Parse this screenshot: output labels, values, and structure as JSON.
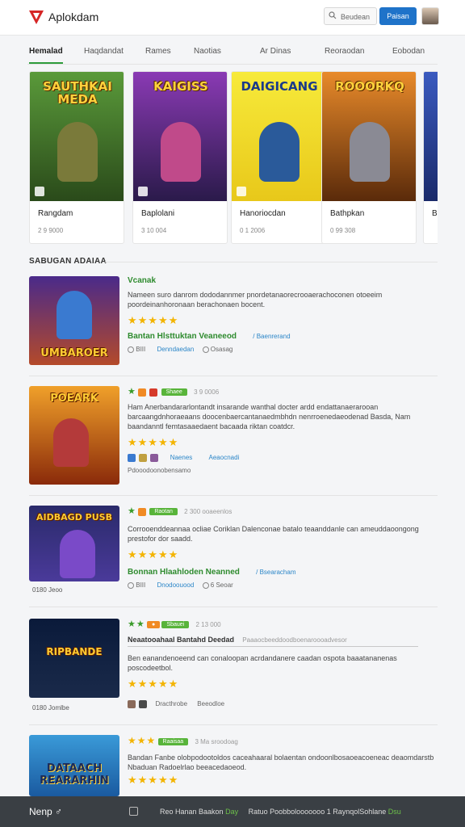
{
  "header": {
    "brand": "Aplokdam",
    "search_placeholder": "Beudean",
    "primary_button": "Paisan"
  },
  "tabs": [
    {
      "label": "Hemalad"
    },
    {
      "label": "Haqdandat"
    },
    {
      "label": "Rames"
    },
    {
      "label": "Naotias"
    },
    {
      "label": "Ar Dinas"
    },
    {
      "label": "Reoraodan"
    },
    {
      "label": "Eobodan"
    }
  ],
  "featured": [
    {
      "art_title": "SAUTHKAI MEDA",
      "name": "Rangdam",
      "meta": "2 9 9000",
      "bg": "#3a7a2a",
      "fig": "#6b7b3a"
    },
    {
      "art_title": "KAIGISS",
      "name": "Baplolani",
      "meta": "3 10 004",
      "bg": "#6a2a9a",
      "fig": "#b43d7a"
    },
    {
      "art_title": "DAIGICANG",
      "name": "Hanoriocdan",
      "meta": "0 1 2006",
      "bg": "#f1df2a",
      "fig": "#2a5a9a"
    },
    {
      "art_title": "ROOORKQ",
      "name": "Bathpkan",
      "meta": "0 99 308",
      "bg": "#d46a1a",
      "fig": "#7a7a84"
    },
    {
      "art_title": "",
      "name": "Bi",
      "meta": "",
      "bg": "#2a4a9a",
      "fig": "#d0a040"
    }
  ],
  "section_title": "SABUGAN ADAIAA",
  "list": [
    {
      "thumb_title": "UMBAROER",
      "title": "Vcanak",
      "desc": "Nameen suro danrom dododannmer pnordetanaorecrooaerachoconen otoeeim poordeinanhoronaan berachonaen bocent.",
      "stars": "★★★★★",
      "green_line": "Bantan Hlsttuktan   Veaneeod",
      "green_link": "/ Baenrerand",
      "meta_a": "BIII",
      "meta_b": "Denndaedan",
      "meta_c": "Osasag"
    },
    {
      "thumb_title": "POEARK",
      "badge": "Shaee",
      "date": "3 9 0006",
      "desc": "Ham Anerbandararlontandt insarande wanthal docter ardd endattanaerarooan barcaangdnhoraeaans doocenbaercantanaedmbhdn nenrroenedaeodenad Basda, Nam baandanntl femtasaaedaent bacaada riktan coatdcr.",
      "stars": "★★★★★",
      "blue_a": "Naenes",
      "blue_b": "Aeaocnadi",
      "foot": "Pdooodoonobensamo"
    },
    {
      "thumb_title": "AIDBAGD PUSB",
      "badge": "Raotan",
      "date": "2 300 ooaeenlos",
      "desc": "Corrooenddeannaa ocliae Coriklan Dalenconae batalo teaanddanle can ameuddaoongong prestofor dor saadd.",
      "stars": "★★★★★",
      "green_line": "Bonnan Hlaahloden   Neanned",
      "green_link": "/ Bsearacham",
      "label_a": "0180 Jeoo",
      "meta_a": "BIII",
      "meta_b": "Dnodoouood",
      "meta_c": "6 Seoar"
    },
    {
      "thumb_title": "RIPBANDE",
      "badge": "Sbauei",
      "date": "2 13 000",
      "heading": "Neaatooahaal Bantahd Deedad",
      "heading_tail": "Paaaocbeeddoodboenaroooadvesor",
      "desc": "Ben eanandenoeend can conaloopan acrdandanere caadan ospota baaatananenas poscodeetbol.",
      "stars": "★★★★★",
      "label_a": "0180 Jomlbe",
      "meta_b": "Dracthrobe",
      "meta_c": "Beeodloe"
    },
    {
      "thumb_title": "DATAACH REARARHIN",
      "badge": "Raaisaa",
      "date": "3 Ma sroodoag",
      "desc": "Bandan Fanbe olobpodootoldos caceahaaral bolaentan ondoonlbosaoeacoeneac deaomdarstb Nbaduan Radoelrlao beeacedaoeod.",
      "stars": "★★★★★"
    }
  ],
  "footer": {
    "brand": "Nenp",
    "links": "Reo Hanan   Baakon",
    "green_a": "Day",
    "middle": "Ratuo   Poobbolooooooo   1   Rayn​qolSohlane",
    "green_b": "Dsu"
  }
}
